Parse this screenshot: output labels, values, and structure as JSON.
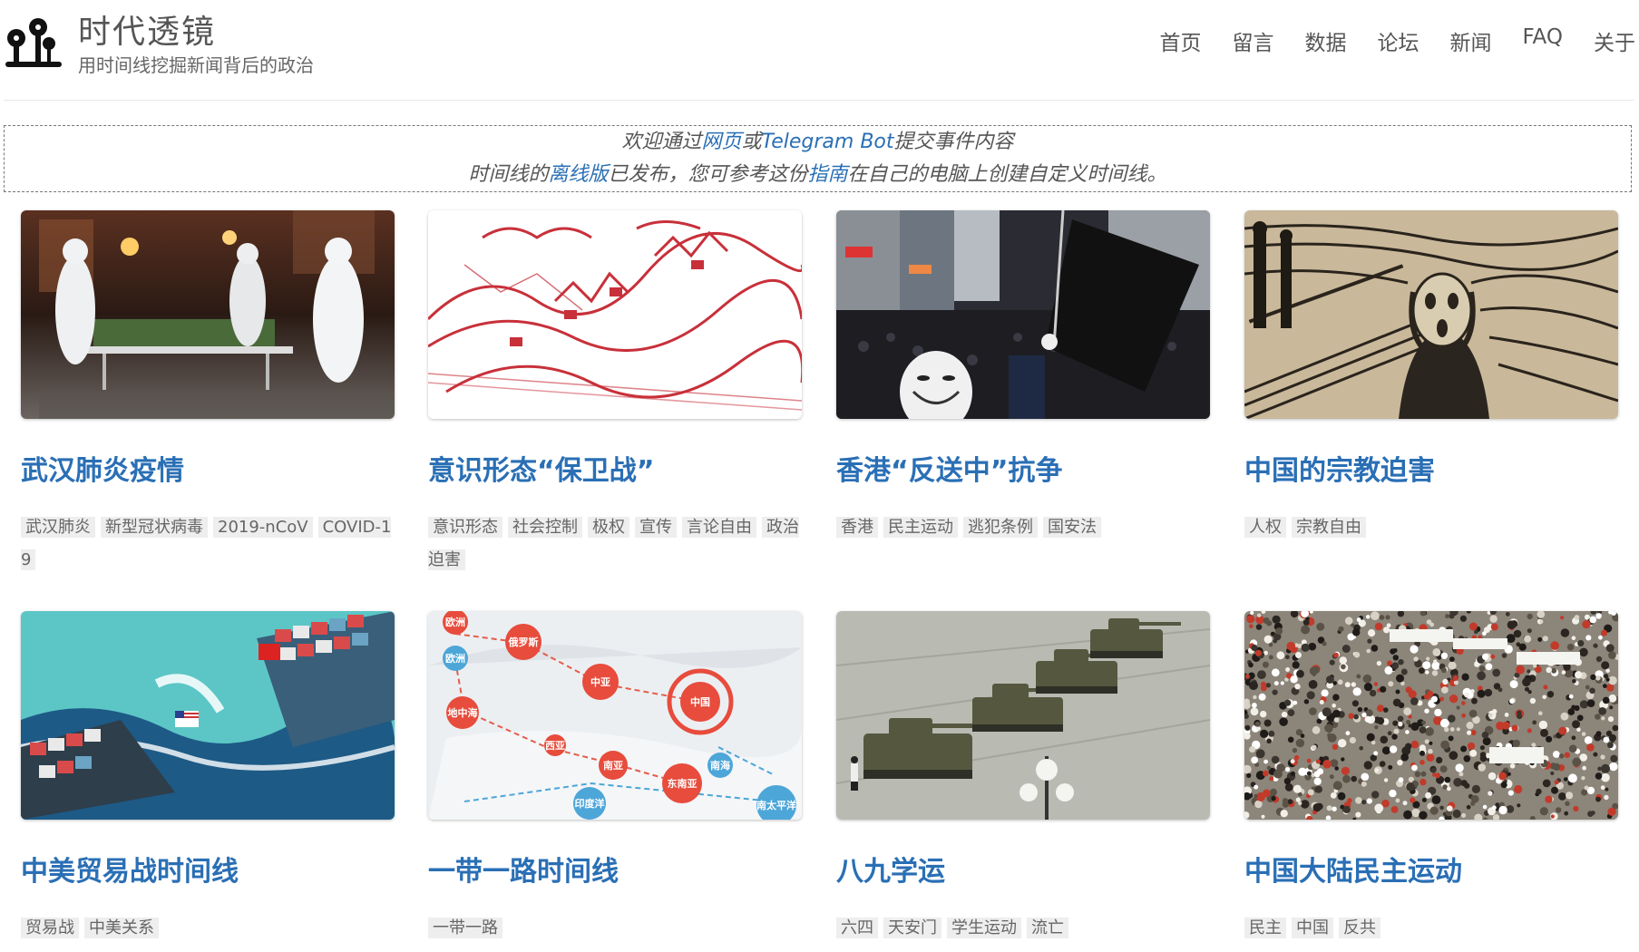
{
  "header": {
    "title": "时代透镜",
    "subtitle": "用时间线挖掘新闻背后的政治",
    "nav": [
      "首页",
      "留言",
      "数据",
      "论坛",
      "新闻",
      "FAQ",
      "关于"
    ]
  },
  "announcement": {
    "line1_pre": "欢迎通过",
    "line1_link1": "网页",
    "line1_mid": "或",
    "line1_link2": "Telegram Bot",
    "line1_post": "提交事件内容",
    "line2_pre": "时间线的",
    "line2_link1": "离线版",
    "line2_mid": "已发布，您可参考这份",
    "line2_link2": "指南",
    "line2_post": "在自己的电脑上创建自定义时间线。"
  },
  "cards": [
    {
      "title": "武汉肺炎疫情",
      "tags": [
        "武汉肺炎",
        "新型冠状病毒",
        "2019-nCoV",
        "COVID-19"
      ],
      "image": "medical-workers-stretcher"
    },
    {
      "title": "意识形态“保卫战”",
      "tags": [
        "意识形态",
        "社会控制",
        "极权",
        "宣传",
        "言论自由",
        "政治迫害"
      ],
      "image": "great-wall-papercut"
    },
    {
      "title": "香港“反送中”抗争",
      "tags": [
        "香港",
        "民主运动",
        "逃犯条例",
        "国安法"
      ],
      "image": "hong-kong-protest"
    },
    {
      "title": "中国的宗教迫害",
      "tags": [
        "人权",
        "宗教自由"
      ],
      "image": "the-scream"
    },
    {
      "title": "中美贸易战时间线",
      "tags": [
        "贸易战",
        "中美关系"
      ],
      "image": "container-ships"
    },
    {
      "title": "一带一路时间线",
      "tags": [
        "一带一路"
      ],
      "image": "belt-road-map"
    },
    {
      "title": "八九学运",
      "tags": [
        "六四",
        "天安门",
        "学生运动",
        "流亡"
      ],
      "image": "tank-man"
    },
    {
      "title": "中国大陆民主运动",
      "tags": [
        "民主",
        "中国",
        "反共"
      ],
      "image": "crowd-protest"
    }
  ],
  "map_labels": [
    "欧洲",
    "俄罗斯",
    "中亚",
    "中国",
    "地中海",
    "西亚",
    "南亚",
    "东南亚",
    "南海",
    "印度洋",
    "南太平洋"
  ],
  "colors": {
    "link": "#2a6fb5",
    "tag_bg": "#eeeeee"
  }
}
